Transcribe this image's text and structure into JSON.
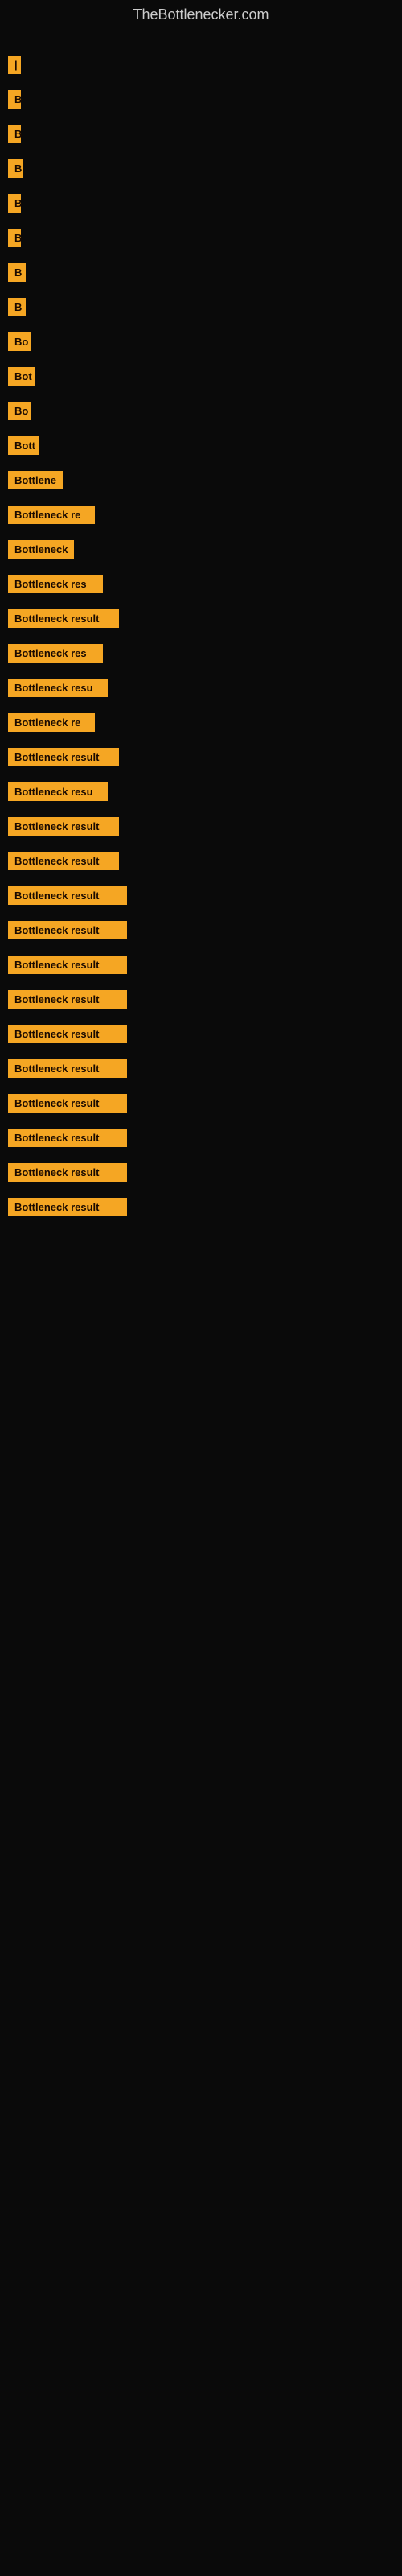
{
  "header": {
    "title": "TheBottlenecker.com"
  },
  "items": [
    {
      "id": 1,
      "label": "|",
      "width": 8
    },
    {
      "id": 2,
      "label": "B",
      "width": 12
    },
    {
      "id": 3,
      "label": "B",
      "width": 14
    },
    {
      "id": 4,
      "label": "B",
      "width": 18
    },
    {
      "id": 5,
      "label": "B",
      "width": 14
    },
    {
      "id": 6,
      "label": "B",
      "width": 16
    },
    {
      "id": 7,
      "label": "B",
      "width": 22
    },
    {
      "id": 8,
      "label": "B",
      "width": 22
    },
    {
      "id": 9,
      "label": "Bo",
      "width": 28
    },
    {
      "id": 10,
      "label": "Bot",
      "width": 34
    },
    {
      "id": 11,
      "label": "Bo",
      "width": 28
    },
    {
      "id": 12,
      "label": "Bott",
      "width": 38
    },
    {
      "id": 13,
      "label": "Bottlene",
      "width": 68
    },
    {
      "id": 14,
      "label": "Bottleneck re",
      "width": 108
    },
    {
      "id": 15,
      "label": "Bottleneck",
      "width": 82
    },
    {
      "id": 16,
      "label": "Bottleneck res",
      "width": 118
    },
    {
      "id": 17,
      "label": "Bottleneck result",
      "width": 138
    },
    {
      "id": 18,
      "label": "Bottleneck res",
      "width": 118
    },
    {
      "id": 19,
      "label": "Bottleneck resu",
      "width": 124
    },
    {
      "id": 20,
      "label": "Bottleneck re",
      "width": 108
    },
    {
      "id": 21,
      "label": "Bottleneck result",
      "width": 138
    },
    {
      "id": 22,
      "label": "Bottleneck resu",
      "width": 124
    },
    {
      "id": 23,
      "label": "Bottleneck result",
      "width": 138
    },
    {
      "id": 24,
      "label": "Bottleneck result",
      "width": 138
    },
    {
      "id": 25,
      "label": "Bottleneck result",
      "width": 148
    },
    {
      "id": 26,
      "label": "Bottleneck result",
      "width": 148
    },
    {
      "id": 27,
      "label": "Bottleneck result",
      "width": 148
    },
    {
      "id": 28,
      "label": "Bottleneck result",
      "width": 148
    },
    {
      "id": 29,
      "label": "Bottleneck result",
      "width": 148
    },
    {
      "id": 30,
      "label": "Bottleneck result",
      "width": 148
    },
    {
      "id": 31,
      "label": "Bottleneck result",
      "width": 148
    },
    {
      "id": 32,
      "label": "Bottleneck result",
      "width": 148
    },
    {
      "id": 33,
      "label": "Bottleneck result",
      "width": 148
    },
    {
      "id": 34,
      "label": "Bottleneck result",
      "width": 148
    }
  ]
}
